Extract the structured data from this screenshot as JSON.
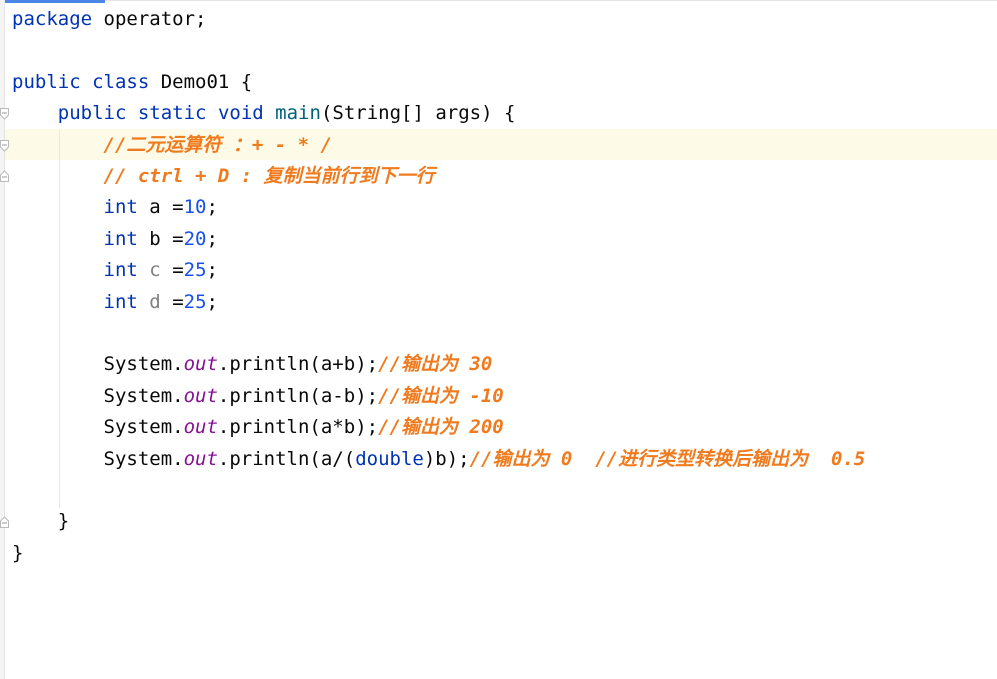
{
  "editor": {
    "lines": [
      {
        "segments": [
          {
            "text": "package",
            "cls": "kw"
          },
          {
            "text": " operator;",
            "cls": "plain"
          }
        ]
      },
      {
        "segments": []
      },
      {
        "segments": [
          {
            "text": "public",
            "cls": "kw"
          },
          {
            "text": " ",
            "cls": "plain"
          },
          {
            "text": "class",
            "cls": "kw"
          },
          {
            "text": " Demo01 {",
            "cls": "plain"
          }
        ]
      },
      {
        "segments": [
          {
            "text": "    ",
            "cls": "plain"
          },
          {
            "text": "public",
            "cls": "kw"
          },
          {
            "text": " ",
            "cls": "plain"
          },
          {
            "text": "static",
            "cls": "kw"
          },
          {
            "text": " ",
            "cls": "plain"
          },
          {
            "text": "void",
            "cls": "kw"
          },
          {
            "text": " ",
            "cls": "plain"
          },
          {
            "text": "main",
            "cls": "fn"
          },
          {
            "text": "(String[] args) {",
            "cls": "plain"
          }
        ]
      },
      {
        "segments": [
          {
            "text": "        ",
            "cls": "plain"
          },
          {
            "text": "//二元运算符 ：+ - * /",
            "cls": "comment"
          }
        ]
      },
      {
        "segments": [
          {
            "text": "        ",
            "cls": "plain"
          },
          {
            "text": "// ctrl + D : 复制当前行到下一行",
            "cls": "comment"
          }
        ]
      },
      {
        "segments": [
          {
            "text": "        ",
            "cls": "plain"
          },
          {
            "text": "int",
            "cls": "kw"
          },
          {
            "text": " a =",
            "cls": "plain"
          },
          {
            "text": "10",
            "cls": "num"
          },
          {
            "text": ";",
            "cls": "plain"
          }
        ]
      },
      {
        "segments": [
          {
            "text": "        ",
            "cls": "plain"
          },
          {
            "text": "int",
            "cls": "kw"
          },
          {
            "text": " b =",
            "cls": "plain"
          },
          {
            "text": "20",
            "cls": "num"
          },
          {
            "text": ";",
            "cls": "plain"
          }
        ]
      },
      {
        "segments": [
          {
            "text": "        ",
            "cls": "plain"
          },
          {
            "text": "int",
            "cls": "kw"
          },
          {
            "text": " ",
            "cls": "plain"
          },
          {
            "text": "c",
            "cls": "unused"
          },
          {
            "text": " =",
            "cls": "plain"
          },
          {
            "text": "25",
            "cls": "num"
          },
          {
            "text": ";",
            "cls": "plain"
          }
        ]
      },
      {
        "segments": [
          {
            "text": "        ",
            "cls": "plain"
          },
          {
            "text": "int",
            "cls": "kw"
          },
          {
            "text": " ",
            "cls": "plain"
          },
          {
            "text": "d",
            "cls": "unused"
          },
          {
            "text": " =",
            "cls": "plain"
          },
          {
            "text": "25",
            "cls": "num"
          },
          {
            "text": ";",
            "cls": "plain"
          }
        ]
      },
      {
        "segments": []
      },
      {
        "segments": [
          {
            "text": "        System.",
            "cls": "plain"
          },
          {
            "text": "out",
            "cls": "static-field"
          },
          {
            "text": ".println(a+b);",
            "cls": "plain"
          },
          {
            "text": "//输出为 30",
            "cls": "comment"
          }
        ]
      },
      {
        "segments": [
          {
            "text": "        System.",
            "cls": "plain"
          },
          {
            "text": "out",
            "cls": "static-field"
          },
          {
            "text": ".println(a-b);",
            "cls": "plain"
          },
          {
            "text": "//输出为 -10",
            "cls": "comment"
          }
        ]
      },
      {
        "segments": [
          {
            "text": "        System.",
            "cls": "plain"
          },
          {
            "text": "out",
            "cls": "static-field"
          },
          {
            "text": ".println(a*b);",
            "cls": "plain"
          },
          {
            "text": "//输出为 200",
            "cls": "comment"
          }
        ]
      },
      {
        "segments": [
          {
            "text": "        System.",
            "cls": "plain"
          },
          {
            "text": "out",
            "cls": "static-field"
          },
          {
            "text": ".println(a/(",
            "cls": "plain"
          },
          {
            "text": "double",
            "cls": "kw"
          },
          {
            "text": ")b);",
            "cls": "plain"
          },
          {
            "text": "//输出为 0  //进行类型转换后输出为  0.5",
            "cls": "comment"
          }
        ]
      },
      {
        "segments": []
      },
      {
        "segments": [
          {
            "text": "    }",
            "cls": "plain"
          }
        ]
      },
      {
        "segments": [
          {
            "text": "}",
            "cls": "plain"
          }
        ]
      }
    ]
  },
  "colors": {
    "keyword": "#0033b3",
    "method": "#00627a",
    "number": "#1750eb",
    "static_field": "#871094",
    "comment": "#f07b1e",
    "unused_variable": "#808080",
    "current_line_background": "#fdfbe7"
  },
  "gutter_icons": [
    "fold-open-icon",
    "fold-close-icon"
  ]
}
